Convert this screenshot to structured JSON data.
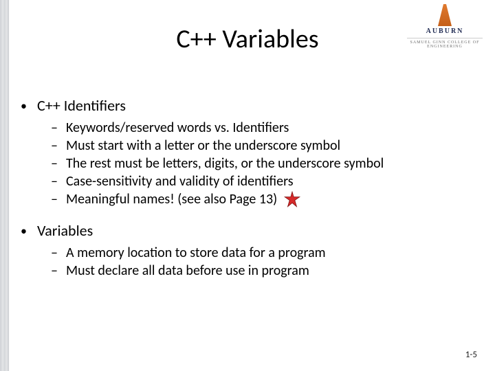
{
  "logo": {
    "university": "AUBURN",
    "college": "SAMUEL GINN COLLEGE OF ENGINEERING"
  },
  "title": "C++ Variables",
  "sections": [
    {
      "heading": "C++ Identifiers",
      "items": [
        {
          "text": "Keywords/reserved words vs. Identifiers",
          "star": false
        },
        {
          "text": "Must start with a letter or the underscore symbol",
          "star": false
        },
        {
          "text": "The rest must be letters, digits, or the underscore symbol",
          "star": false
        },
        {
          "text": "Case-sensitivity and validity of identifiers",
          "star": false
        },
        {
          "text": "Meaningful names! (see also Page 13)",
          "star": true
        }
      ]
    },
    {
      "heading": "Variables",
      "items": [
        {
          "text": "A memory location to store data for a program",
          "star": false
        },
        {
          "text": "Must declare all data before use in program",
          "star": false
        }
      ]
    }
  ],
  "page_number": "1-5"
}
